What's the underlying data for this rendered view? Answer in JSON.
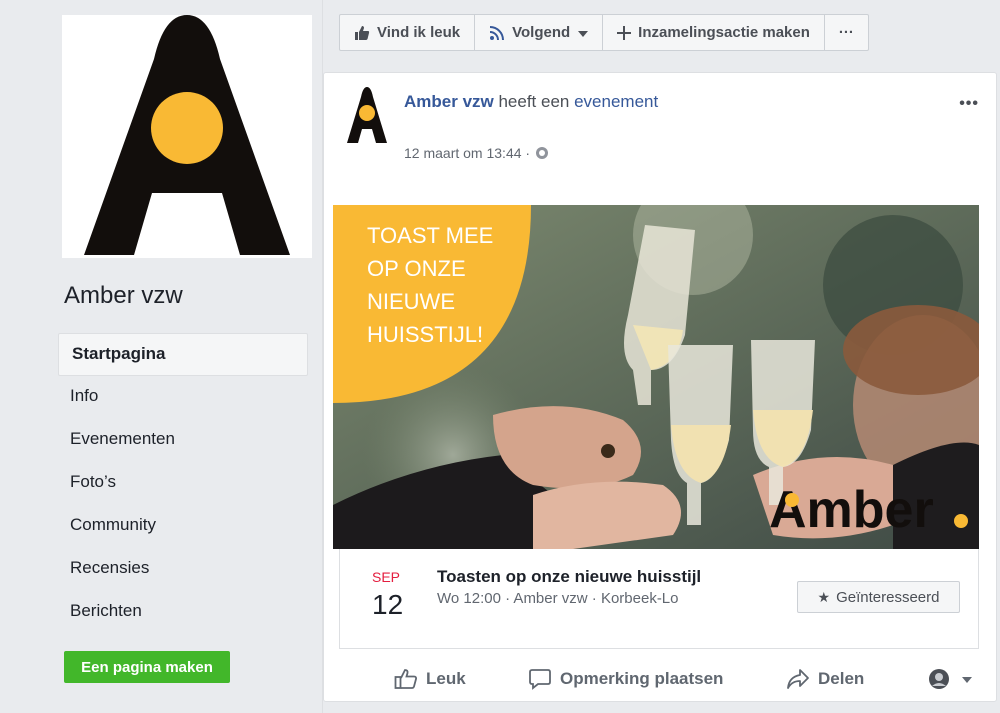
{
  "sidebar": {
    "page_name": "Amber vzw",
    "items": [
      {
        "label": "Startpagina",
        "active": true
      },
      {
        "label": "Info"
      },
      {
        "label": "Evenementen"
      },
      {
        "label": "Foto’s"
      },
      {
        "label": "Community"
      },
      {
        "label": "Recensies"
      },
      {
        "label": "Berichten"
      }
    ],
    "create_page_label": "Een pagina maken"
  },
  "actionbar": {
    "like": "Vind ik leuk",
    "follow": "Volgend",
    "fundraiser": "Inzamelingsactie maken",
    "more": "···"
  },
  "post": {
    "author": "Amber vzw",
    "action": " heeft een ",
    "action_link": "evenement",
    "time": "12 maart om 13:44 ·",
    "menu": "•••",
    "image_text_lines": [
      "TOAST MEE",
      "OP ONZE",
      "NIEUWE",
      "HUISSTIJL!"
    ],
    "image_logo": "Amber",
    "event": {
      "month": "SEP",
      "day": "12",
      "title": "Toasten op onze nieuwe huisstijl",
      "subtitle": "Wo 12:00 · Amber vzw · Korbeek-Lo",
      "interested_label": "Geïnteresseerd"
    },
    "actions": {
      "like": "Leuk",
      "comment": "Opmerking plaatsen",
      "share": "Delen"
    }
  },
  "colors": {
    "brand_yellow": "#f9b934",
    "brand_black": "#120e0c",
    "fb_blue": "#365899",
    "green": "#42b72a"
  }
}
